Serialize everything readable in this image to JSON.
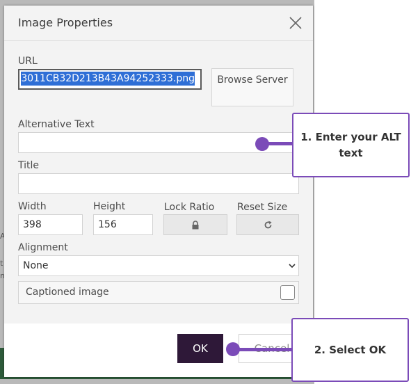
{
  "background": {
    "fragments": [
      "A",
      "t",
      "n"
    ]
  },
  "dialog": {
    "title": "Image Properties",
    "url": {
      "label": "URL",
      "value": "3011CB32D213B43A94252333.png"
    },
    "browse_server_label": "Browse Server",
    "alt_text": {
      "label": "Alternative Text",
      "value": ""
    },
    "title_field": {
      "label": "Title",
      "value": ""
    },
    "width": {
      "label": "Width",
      "value": "398"
    },
    "height": {
      "label": "Height",
      "value": "156"
    },
    "lock_ratio": {
      "label": "Lock Ratio",
      "icon": "lock-icon"
    },
    "reset_size": {
      "label": "Reset Size",
      "icon": "refresh-icon"
    },
    "alignment": {
      "label": "Alignment",
      "selected": "None"
    },
    "captioned_image": {
      "label": "Captioned image",
      "checked": false
    },
    "ok_label": "OK",
    "cancel_label": "Cancel"
  },
  "callouts": {
    "alt": "1. Enter your ALT text",
    "ok": "2. Select OK"
  },
  "colors": {
    "accent": "#7b4bb8",
    "ok_button": "#2e1838",
    "selection": "#2f6fd6"
  }
}
